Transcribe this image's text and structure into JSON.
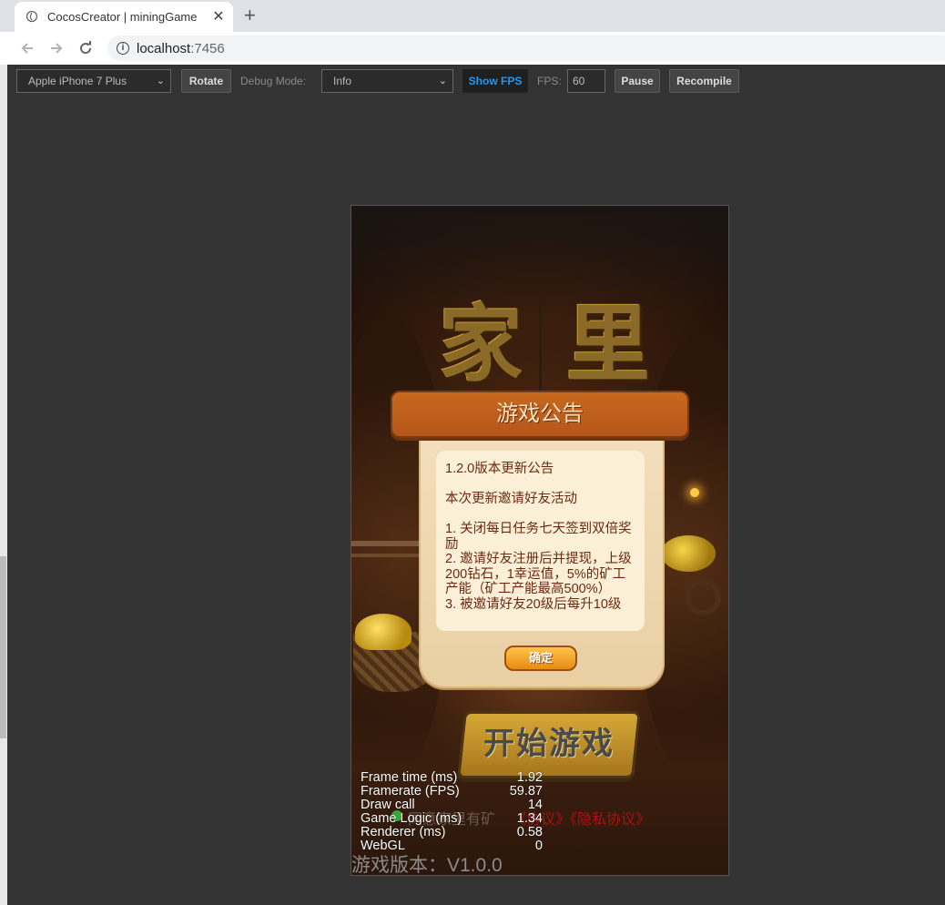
{
  "browser": {
    "tab_title": "CocosCreator | miningGame",
    "tab_close": "✕",
    "new_tab": "+",
    "url_host": "localhost",
    "url_port": ":7456"
  },
  "sim_toolbar": {
    "device": "Apple iPhone 7 Plus",
    "rotate": "Rotate",
    "debug_mode_label": "Debug Mode:",
    "debug_mode_value": "Info",
    "show_fps": "Show FPS",
    "fps_label": "FPS:",
    "fps_value": "60",
    "pause": "Pause",
    "recompile": "Recompile"
  },
  "game": {
    "title_left": "家",
    "title_right": "里",
    "notice": {
      "title": "游戏公告",
      "lines": [
        "1.2.0版本更新公告",
        "",
        "本次更新邀请好友活动",
        "",
        "1. 关闭每日任务七天签到双倍奖励",
        "2. 邀请好友注册后并提现，上级200钻石，1幸运值，5%的矿工产能（矿工产能最高500%）",
        "3. 被邀请好友20级后每升10级"
      ],
      "ok": "确定"
    },
    "start": "开始游戏",
    "agree_text": "同意家里有矿",
    "agree_link": "《协议》《隐私协议》",
    "version": "游戏版本：V1.0.0"
  },
  "stats": [
    {
      "label": "Frame time (ms)",
      "value": "1.92"
    },
    {
      "label": "Framerate (FPS)",
      "value": "59.87"
    },
    {
      "label": "Draw call",
      "value": "14"
    },
    {
      "label": "Game Logic (ms)",
      "value": "1.34"
    },
    {
      "label": "Renderer (ms)",
      "value": "0.58"
    },
    {
      "label": "WebGL",
      "value": "0"
    }
  ],
  "colors": {
    "panel": "#333333",
    "show_fps_active": "#2196f3",
    "notice_header": "#b4561a",
    "notice_text": "#6a2a10",
    "link_red": "#b01010"
  }
}
